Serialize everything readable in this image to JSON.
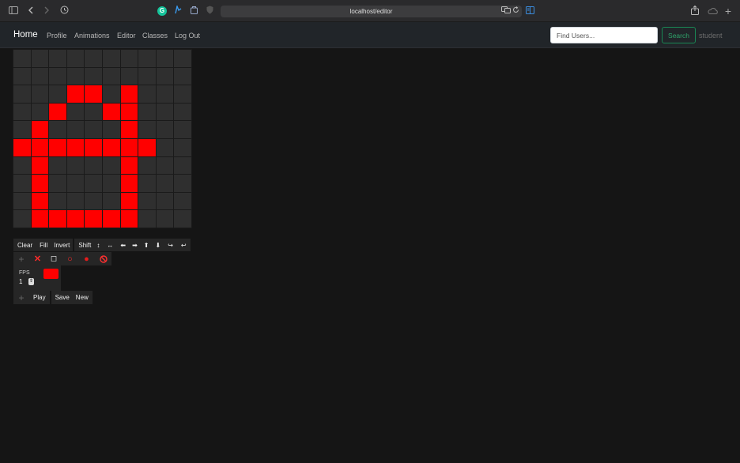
{
  "browser": {
    "url": "localhost/editor",
    "icons": [
      "sidebar-icon",
      "back-icon",
      "forward-icon",
      "history-icon",
      "grammarly-icon",
      "extension-icon",
      "password-icon",
      "privacy-icon",
      "translate-icon",
      "reload-icon",
      "reader-icon",
      "share-icon",
      "cloud-icon",
      "new-tab-icon"
    ]
  },
  "navbar": {
    "brand": "Home",
    "links": [
      "Profile",
      "Animations",
      "Editor",
      "Classes",
      "Log Out"
    ],
    "search_placeholder": "Find Users...",
    "search_label": "Search",
    "username": "student"
  },
  "editor": {
    "grid_size": 10,
    "pixel_color": "#ff0000",
    "off_color": "#2f2f2f",
    "pixels": [
      [
        0,
        0,
        0,
        0,
        0,
        0,
        0,
        0,
        0,
        0
      ],
      [
        0,
        0,
        0,
        0,
        0,
        0,
        0,
        0,
        0,
        0
      ],
      [
        0,
        0,
        0,
        1,
        1,
        0,
        1,
        0,
        0,
        0
      ],
      [
        0,
        0,
        1,
        0,
        0,
        1,
        1,
        0,
        0,
        0
      ],
      [
        0,
        1,
        0,
        0,
        0,
        0,
        1,
        0,
        0,
        0
      ],
      [
        1,
        1,
        1,
        1,
        1,
        1,
        1,
        1,
        0,
        0
      ],
      [
        0,
        1,
        0,
        0,
        0,
        0,
        1,
        0,
        0,
        0
      ],
      [
        0,
        1,
        0,
        0,
        0,
        0,
        1,
        0,
        0,
        0
      ],
      [
        0,
        1,
        0,
        0,
        0,
        0,
        1,
        0,
        0,
        0
      ],
      [
        0,
        1,
        1,
        1,
        1,
        1,
        1,
        0,
        0,
        0
      ]
    ],
    "toolbar": {
      "clear": "Clear",
      "fill": "Fill",
      "invert": "Invert",
      "shift": "Shift",
      "shift_arrows": "↕",
      "flip_horizontal": "↔",
      "shift_left": "⬅",
      "shift_right": "➡",
      "shift_up": "⬆",
      "shift_down": "⬇",
      "rotate": "↪",
      "undo": "↩"
    },
    "tools": {
      "add": "+",
      "delete": "✕",
      "square": "◻",
      "circle": "○",
      "filled_circle": "●",
      "forbid": "⃠"
    },
    "fps_label": "FPS",
    "fps_value": "1",
    "current_color": "#ff0000",
    "frame_controls": {
      "add": "+",
      "play": "Play",
      "save": "Save",
      "new": "New"
    }
  }
}
